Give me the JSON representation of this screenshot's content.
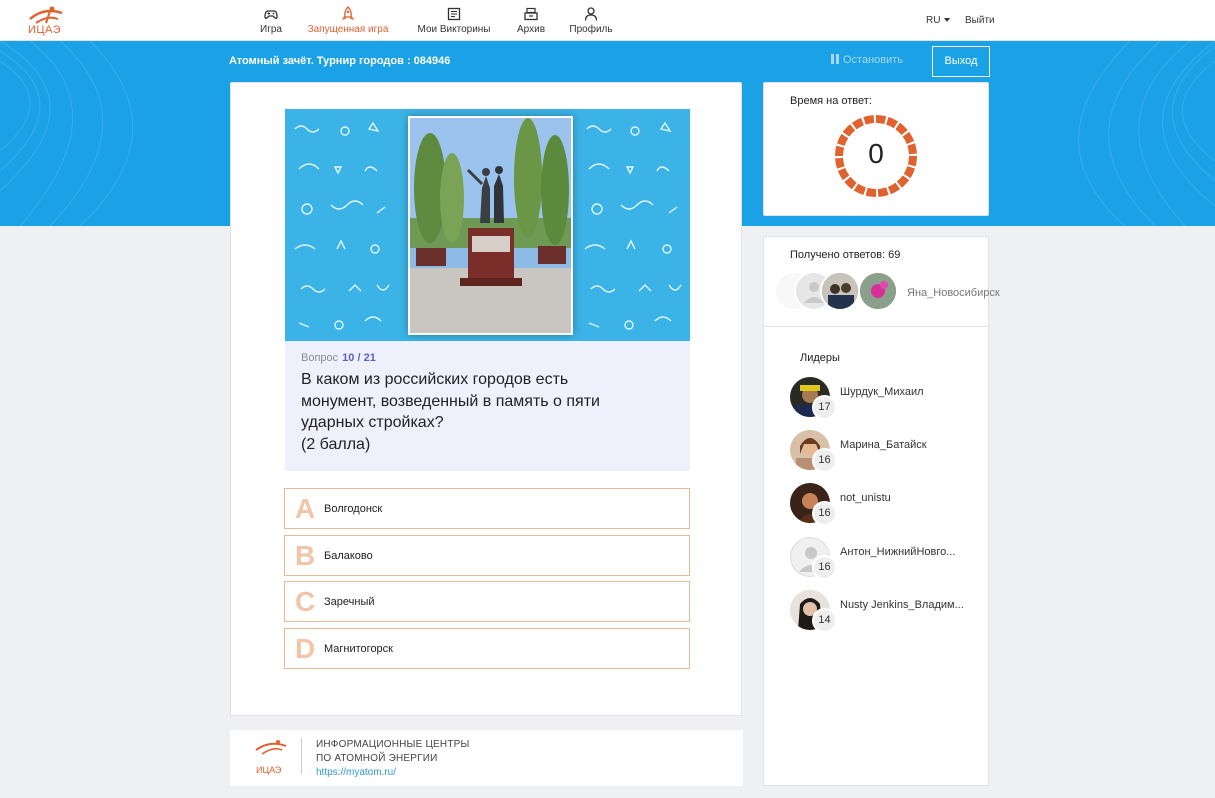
{
  "app": {
    "logo_text": "ИЦАЭ"
  },
  "nav": {
    "items": [
      {
        "label": "Игра",
        "icon": "gamepad-icon"
      },
      {
        "label": "Запущенная игра",
        "icon": "rocket-icon",
        "active": true
      },
      {
        "label": "Мои Викторины",
        "icon": "quiz-list-icon"
      },
      {
        "label": "Архив",
        "icon": "archive-icon"
      },
      {
        "label": "Профиль",
        "icon": "user-icon"
      }
    ],
    "lang": "RU",
    "logout": "Выйти"
  },
  "game": {
    "title": "Атомный зачёт. Турнир городов : 084946",
    "stop_label": "Остановить",
    "exit_label": "Выход"
  },
  "question": {
    "label": "Вопрос",
    "number": "10",
    "total": "/ 21",
    "text_lines": [
      "В каком из российских городов есть",
      "монумент, возведенный в память о пяти",
      "ударных стройках?",
      "(2 балла)"
    ]
  },
  "answers": [
    {
      "letter": "A",
      "text": "Волгодонск"
    },
    {
      "letter": "B",
      "text": "Балаково"
    },
    {
      "letter": "C",
      "text": "Заречный"
    },
    {
      "letter": "D",
      "text": "Магнитогорск"
    }
  ],
  "timer": {
    "label": "Время на ответ:",
    "value": "0",
    "color": "#e0622e"
  },
  "responses": {
    "label": "Получено ответов: 69",
    "latest_name": "Яна_Новосибирск"
  },
  "leaders": {
    "title": "Лидеры",
    "items": [
      {
        "name": "Шурдук_Михаил",
        "score": "17"
      },
      {
        "name": "Марина_Батайск",
        "score": "16"
      },
      {
        "name": "not_unistu",
        "score": "16"
      },
      {
        "name": "Антон_НижнийНовго...",
        "score": "16"
      },
      {
        "name": "Nusty Jenkins_Владим...",
        "score": "14"
      }
    ]
  },
  "footer": {
    "logo_text": "ИЦАЭ",
    "line1": "ИНФОРМАЦИОННЫЕ ЦЕНТРЫ",
    "line2": "ПО АТОМНОЙ ЭНЕРГИИ",
    "url": "https://myatom.ru/"
  },
  "colors": {
    "brand_orange": "#e0622e",
    "banner_blue": "#1ba2e6",
    "accent_purple": "#5b5fc7"
  }
}
